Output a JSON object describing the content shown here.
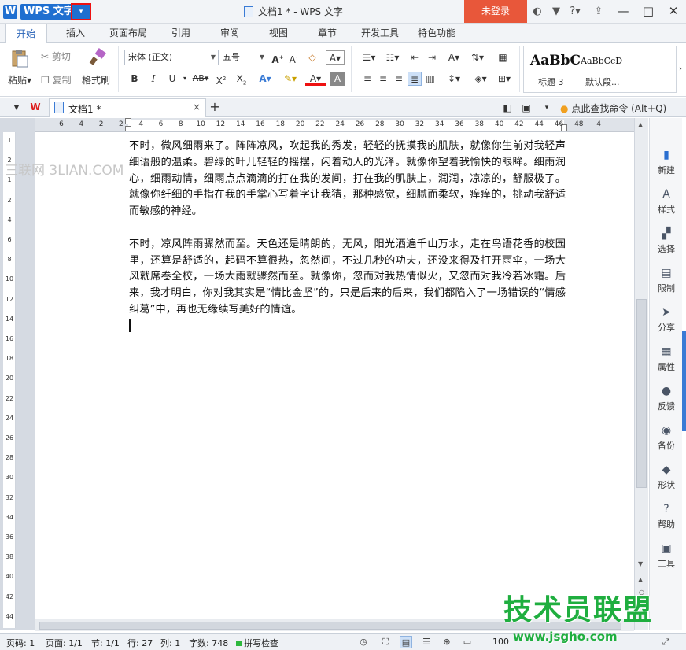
{
  "titlebar": {
    "app_name": "WPS 文字",
    "app_logo_letter": "W",
    "menu_arrow": "▾",
    "doc_title": "文档1 * - WPS 文字",
    "login_label": "未登录",
    "help_label": "?",
    "accent_color": "#1f6fd0",
    "login_color": "#e8573a"
  },
  "ribbon_tabs": [
    "开始",
    "插入",
    "页面布局",
    "引用",
    "审阅",
    "视图",
    "章节",
    "开发工具",
    "特色功能"
  ],
  "ribbon": {
    "paste": "粘贴",
    "cut": "剪切",
    "copy": "复制",
    "format_painter": "格式刷",
    "font_name": "宋体 (正文)",
    "font_size": "五号",
    "style_sample_1": "AaBbC",
    "style_sample_2": "AaBbCcD",
    "style_name_1": "标题 3",
    "style_name_2": "默认段..."
  },
  "doctab": {
    "label": "文档1 *",
    "close": "×",
    "add": "+",
    "find_command": "点此查找命令 (Alt+Q)"
  },
  "ruler": {
    "h_ticks": [
      "6",
      "4",
      "2",
      "2",
      "4",
      "6",
      "8",
      "10",
      "12",
      "14",
      "16",
      "18",
      "20",
      "22",
      "24",
      "26",
      "28",
      "30",
      "32",
      "34",
      "36",
      "38",
      "40",
      "42",
      "44",
      "46",
      "48",
      "4"
    ],
    "v_ticks": [
      "1",
      "2",
      "1",
      "2",
      "4",
      "6",
      "8",
      "10",
      "12",
      "14",
      "16",
      "18",
      "20",
      "22",
      "24",
      "26",
      "28",
      "30",
      "32",
      "34",
      "36",
      "38",
      "40",
      "42",
      "44"
    ]
  },
  "document": {
    "watermark": "三联网 3LIAN.COM",
    "paragraphs": [
      "不时，微风细雨来了。阵阵凉风，吹起我的秀发，轻轻的抚摸我的肌肤，就像你生前对我轻声细语般的温柔。碧绿的叶儿轻轻的摇摆，闪着动人的光泽。就像你望着我愉快的眼眸。细雨润心，细雨动情，细雨点点滴滴的打在我的发间，打在我的肌肤上，润润，凉凉的，舒服极了。就像你纤细的手指在我的手掌心写着字让我猜，那种感觉，细腻而柔软，痒痒的，挑动我舒适而敏感的神经。",
      "不时，凉风阵雨骤然而至。天色还是晴朗的，无风，阳光洒遍千山万水，走在鸟语花香的校园里，还算是舒适的，起码不算很热，忽然间，不过几秒的功夫，还没来得及打开雨伞，一场大风就席卷全校，一场大雨就骤然而至。就像你，忽而对我热情似火，又忽而对我冷若冰霜。后来，我才明白，你对我其实是“情比金坚”的，只是后来的后来，我们都陷入了一场错误的“情感纠葛”中，再也无缘续写美好的情谊。"
    ]
  },
  "side_panel": [
    {
      "label": "新建",
      "icon": "new-doc-icon",
      "glyph": "▮"
    },
    {
      "label": "样式",
      "icon": "style-icon",
      "glyph": "A"
    },
    {
      "label": "选择",
      "icon": "select-icon",
      "glyph": "▞"
    },
    {
      "label": "限制",
      "icon": "restrict-icon",
      "glyph": "▤"
    },
    {
      "label": "分享",
      "icon": "share-icon",
      "glyph": "➤"
    },
    {
      "label": "属性",
      "icon": "properties-icon",
      "glyph": "▦"
    },
    {
      "label": "反馈",
      "icon": "feedback-icon",
      "glyph": "●"
    },
    {
      "label": "备份",
      "icon": "backup-icon",
      "glyph": "◉"
    },
    {
      "label": "形状",
      "icon": "shape-icon",
      "glyph": "◆"
    },
    {
      "label": "帮助",
      "icon": "help-icon",
      "glyph": "?"
    },
    {
      "label": "工具",
      "icon": "toolbox-icon",
      "glyph": "▣"
    }
  ],
  "statusbar": {
    "page_code": "页码: 1",
    "page": "页面: 1/1",
    "section": "节: 1/1",
    "row": "行: 27",
    "col": "列: 1",
    "word_count": "字数: 748",
    "spell_check": "拼写检查",
    "zoom": "100"
  },
  "brand": {
    "name": "技术员联盟",
    "url": "www.jsgho.com",
    "color": "#1fae3f"
  }
}
